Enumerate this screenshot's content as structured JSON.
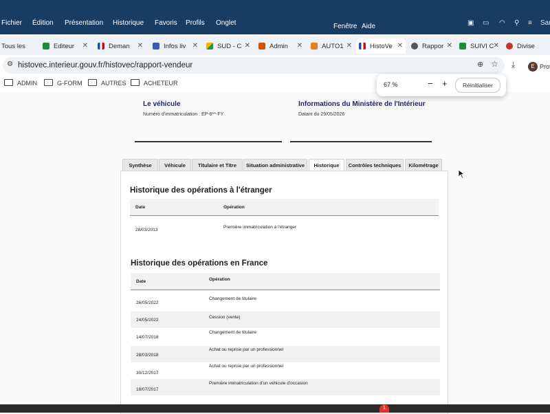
{
  "menubar": {
    "items": [
      "Fichier",
      "Édition",
      "Présentation",
      "Historique",
      "Favoris",
      "Profils",
      "Onglet",
      "Fenêtre",
      "Aide"
    ],
    "user_label": "Sam"
  },
  "tabs": [
    {
      "label": "Tous les",
      "icon": "list-icon",
      "color": "#9aa3ad",
      "active": false
    },
    {
      "label": "Editeur",
      "icon": "spreadsheet-icon",
      "color": "#1e8e3e",
      "active": false
    },
    {
      "label": "Deman",
      "icon": "french-flag-icon",
      "color": "#1f4fa1",
      "active": false
    },
    {
      "label": "Infos liv",
      "icon": "table-icon",
      "color": "#3b5bb5",
      "active": false
    },
    {
      "label": "SUD - C",
      "icon": "drive-icon",
      "color": "#f4b400",
      "active": false
    },
    {
      "label": "Admin",
      "icon": "admin-icon",
      "color": "#d35400",
      "active": false
    },
    {
      "label": "AUTO1",
      "icon": "auto1-icon",
      "color": "#e67e22",
      "active": false
    },
    {
      "label": "HistoVe",
      "icon": "french-flag-icon",
      "color": "#1f4fa1",
      "active": true
    },
    {
      "label": "Rappor",
      "icon": "globe-icon",
      "color": "#555555",
      "active": false
    },
    {
      "label": "SUIVI C",
      "icon": "spreadsheet-icon",
      "color": "#1e8e3e",
      "active": false
    },
    {
      "label": "Divise",
      "icon": "heart-icon",
      "color": "#c0392b",
      "active": false
    }
  ],
  "address_bar": {
    "url": "histovec.interieur.gouv.fr/histovec/rapport-vendeur"
  },
  "profile": {
    "initial": "E",
    "label": "Prof"
  },
  "bookmarks": [
    "ADMIN",
    "G-FORM",
    "AUTRES",
    "ACHETEUR"
  ],
  "zoom_popup": {
    "level": "67 %",
    "minus": "−",
    "plus": "+",
    "reset_label": "Réinitialiser"
  },
  "vehicle_card": {
    "title": "Le véhicule",
    "plate_text": "Numéro d'immatriculation : EP-6**-FY"
  },
  "ministry_card": {
    "title": "Informations du Ministère de l'Intérieur",
    "date_text": "Datant du 29/05/2026"
  },
  "report_tabs": [
    "Synthèse",
    "Véhicule",
    "Titulaire et Titre",
    "Situation administrative",
    "Historique",
    "Contrôles techniques",
    "Kilométrage"
  ],
  "active_report_tab": "Historique",
  "foreign_history": {
    "title": "Historique des opérations à l'étranger",
    "col_date": "Date",
    "col_operation": "Opération",
    "rows": [
      {
        "date": "28/03/2013",
        "operation": "Première immatriculation à l'étranger"
      }
    ]
  },
  "france_history": {
    "title": "Historique des opérations en France",
    "col_date": "Date",
    "col_operation": "Opération",
    "rows": [
      {
        "date": "26/05/2022",
        "operation": "Changement de titulaire"
      },
      {
        "date": "24/05/2022",
        "operation": "Cession (vente)"
      },
      {
        "date": "14/07/2018",
        "operation": "Changement de titulaire"
      },
      {
        "date": "28/03/2018",
        "operation": "Achat ou reprise par un professionnel"
      },
      {
        "date": "30/12/2017",
        "operation": "Achat ou reprise par un professionnel"
      },
      {
        "date": "18/07/2017",
        "operation": "Première immatriculation d'un véhicule d'occasion"
      }
    ]
  },
  "dock": {
    "badge": "1"
  }
}
